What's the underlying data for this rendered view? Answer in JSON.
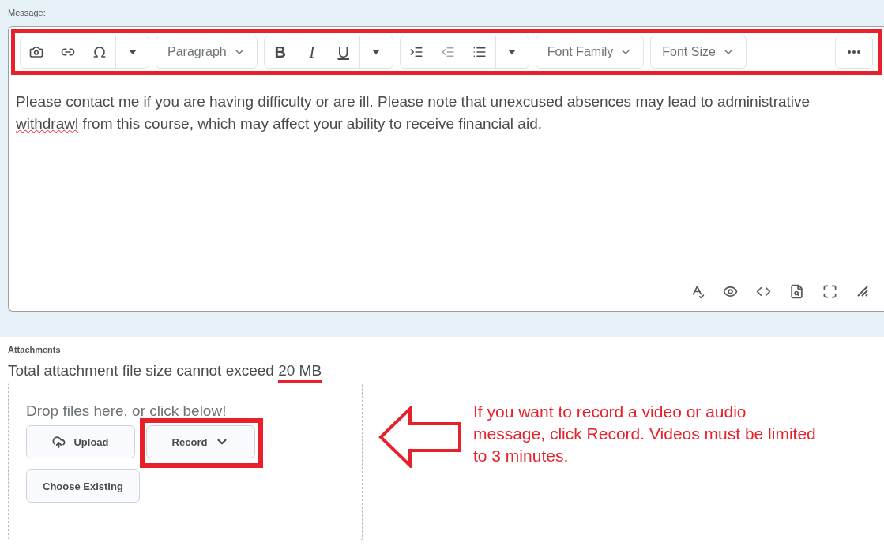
{
  "message_label": "Message:",
  "toolbar": {
    "highlighted": true,
    "groups": [
      {
        "kind": "insert"
      },
      {
        "kind": "select",
        "label": "Paragraph"
      },
      {
        "kind": "format",
        "items": [
          "B",
          "I",
          "U"
        ]
      },
      {
        "kind": "lists"
      },
      {
        "kind": "select",
        "label": "Font Family"
      },
      {
        "kind": "select",
        "label": "Font Size"
      },
      {
        "kind": "more"
      }
    ]
  },
  "body": [
    {
      "text": "Please contact me if you are having difficulty or are ill. Please note that unexcused absences may lead to administrative ",
      "misspelled": false
    },
    {
      "text": "withdrawl",
      "misspelled": true
    },
    {
      "text": " from this course, which may affect your ability to receive financial aid.",
      "misspelled": false
    }
  ],
  "attachments": {
    "label": "Attachments",
    "limit": [
      {
        "text": "Total attachment file size cannot exceed ",
        "underlined": false
      },
      {
        "text": "20 MB",
        "underlined": true
      }
    ],
    "drop_hint": "Drop files here, or click below!",
    "buttons": [
      {
        "kind": "upload",
        "label": "Upload",
        "highlighted": false
      },
      {
        "kind": "menu",
        "label": "Record",
        "highlighted": true
      },
      {
        "kind": "plain",
        "label": "Choose Existing",
        "highlighted": false
      }
    ]
  },
  "callout": {
    "text": "If you want to record a video or audio message, click Record. Videos must be limited to 3 minutes.",
    "color": "#e8202a"
  }
}
